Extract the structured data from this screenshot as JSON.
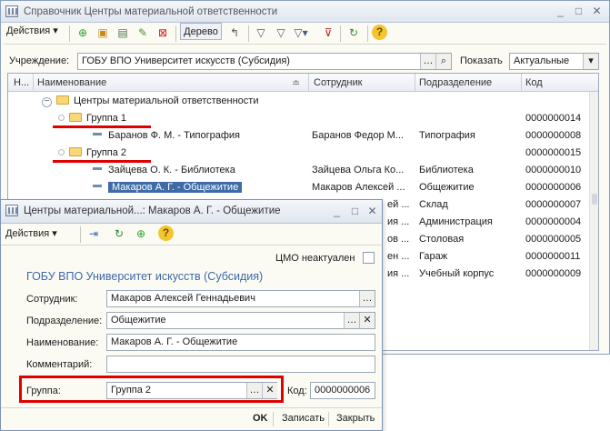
{
  "main_window": {
    "title": "Справочник Центры материальной ответственности",
    "toolbar": {
      "actions_label": "Действия",
      "tree_label": "Дерево"
    },
    "filter": {
      "institution_label": "Учреждение:",
      "institution_value": "ГОБУ ВПО Университет искусств (Субсидия)",
      "show_label": "Показать",
      "show_value": "Актуальные"
    },
    "columns": [
      "Н...",
      "Наименование",
      "Сотрудник",
      "Подразделение",
      "Код"
    ],
    "rows": [
      {
        "name": "Центры материальной ответственности",
        "employee": "",
        "department": "",
        "code": ""
      },
      {
        "name": "Группа 1",
        "employee": "",
        "department": "",
        "code": "0000000014"
      },
      {
        "name": "Баранов Ф. М. - Типография",
        "employee": "Баранов Федор М...",
        "department": "Типография",
        "code": "0000000008"
      },
      {
        "name": "Группа 2",
        "employee": "",
        "department": "",
        "code": "0000000015"
      },
      {
        "name": "Зайцева О. К. - Библиотека",
        "employee": "Зайцева Ольга Ко...",
        "department": "Библиотека",
        "code": "0000000010"
      },
      {
        "name": "Макаров А. Г. - Общежитие",
        "employee": "Макаров Алексей ...",
        "department": "Общежитие",
        "code": "0000000006"
      },
      {
        "name": "",
        "employee": "ей ...",
        "department": "Склад",
        "code": "0000000007"
      },
      {
        "name": "",
        "employee": "ия ...",
        "department": "Администрация",
        "code": "0000000004"
      },
      {
        "name": "",
        "employee": "ов ...",
        "department": "Столовая",
        "code": "0000000005"
      },
      {
        "name": "",
        "employee": "ен ...",
        "department": "Гараж",
        "code": "0000000011"
      },
      {
        "name": "",
        "employee": "ия ...",
        "department": "Учебный корпус",
        "code": "0000000009"
      }
    ]
  },
  "dialog": {
    "title": "Центры материальной...: Макаров А. Г. - Общежитие",
    "actions_label": "Действия",
    "cmo_label": "ЦМО неактуален",
    "cmo_checked": false,
    "section_title": "ГОБУ ВПО Университет искусств (Субсидия)",
    "employee_label": "Сотрудник:",
    "employee_value": "Макаров Алексей Геннадьевич",
    "department_label": "Подразделение:",
    "department_value": "Общежитие",
    "name_label": "Наименование:",
    "name_value": "Макаров А. Г. - Общежитие",
    "comment_label": "Комментарий:",
    "comment_value": "",
    "group_label": "Группа:",
    "group_value": "Группа 2",
    "code_label": "Код:",
    "code_value": "0000000006",
    "ok_label": "OK",
    "save_label": "Записать",
    "close_label": "Закрыть"
  },
  "colors": {
    "accent_blue": "#3f6ca8",
    "highlight_red": "#e00000",
    "window_bg": "#fbfbf4"
  }
}
